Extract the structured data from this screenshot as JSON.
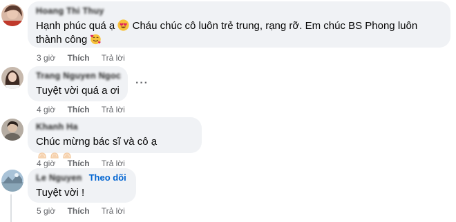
{
  "comments": [
    {
      "author": "Hoang Thi Thuy",
      "text_a": "Hạnh phúc quá ạ",
      "text_b": "Cháu chúc cô luôn trẻ trung, rạng rỡ. Em chúc BS Phong luôn",
      "text_c": "thành công",
      "time": "3 giờ",
      "like": "Thích",
      "reply": "Trả lời"
    },
    {
      "author": "Trang Nguyen Ngoc",
      "text": "Tuyệt vời quá a ơi",
      "time": "4 giờ",
      "like": "Thích",
      "reply": "Trả lời",
      "more": "···"
    },
    {
      "author": "Khanh Ha",
      "text": "Chúc mừng bác sĩ và cô ạ",
      "time": "4 giờ",
      "like": "Thích",
      "reply": "Trả lời"
    },
    {
      "author": "Le Nguyen",
      "follow": "Theo dõi",
      "text": "Tuyệt vời !",
      "time": "5 giờ",
      "like": "Thích",
      "reply": "Trả lời"
    }
  ],
  "colors": {
    "bubble": "#f0f2f5",
    "link": "#0064d1",
    "meta": "#65676b"
  },
  "icons": [
    "heart-eyes-emoji",
    "smiling-hearts-emoji",
    "clapping-hands-emoji",
    "more-options-icon"
  ]
}
